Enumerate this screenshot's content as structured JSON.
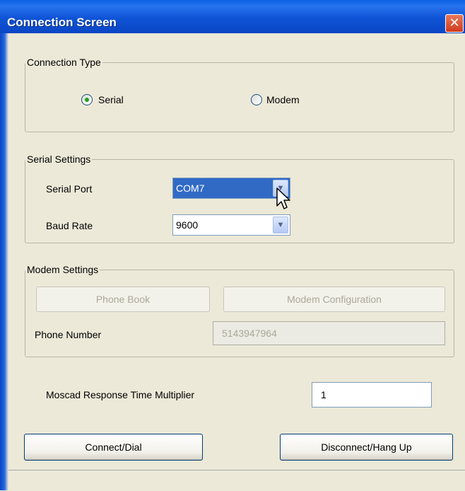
{
  "window": {
    "title": "Connection Screen",
    "close_glyph": "✕"
  },
  "connection_type": {
    "legend": "Connection Type",
    "options": [
      {
        "label": "Serial",
        "selected": true
      },
      {
        "label": "Modem",
        "selected": false
      }
    ]
  },
  "serial_settings": {
    "legend": "Serial Settings",
    "port_label": "Serial Port",
    "port_value": "COM7",
    "baud_label": "Baud Rate",
    "baud_value": "9600"
  },
  "modem_settings": {
    "legend": "Modem Settings",
    "phone_book_label": "Phone Book",
    "modem_config_label": "Modem Configuration",
    "phone_number_label": "Phone Number",
    "phone_number_value": "5143947964"
  },
  "response": {
    "label": "Moscad Response Time Multiplier",
    "value": "1"
  },
  "actions": {
    "connect_label": "Connect/Dial",
    "disconnect_label": "Disconnect/Hang Up"
  },
  "icons": {
    "dropdown": "chevron-down-icon",
    "cursor": "mouse-pointer-icon"
  },
  "colors": {
    "titlebar": "#0a5fe0",
    "selection": "#316ac5",
    "radio_dot": "#21a121",
    "close": "#cf3b1e"
  }
}
